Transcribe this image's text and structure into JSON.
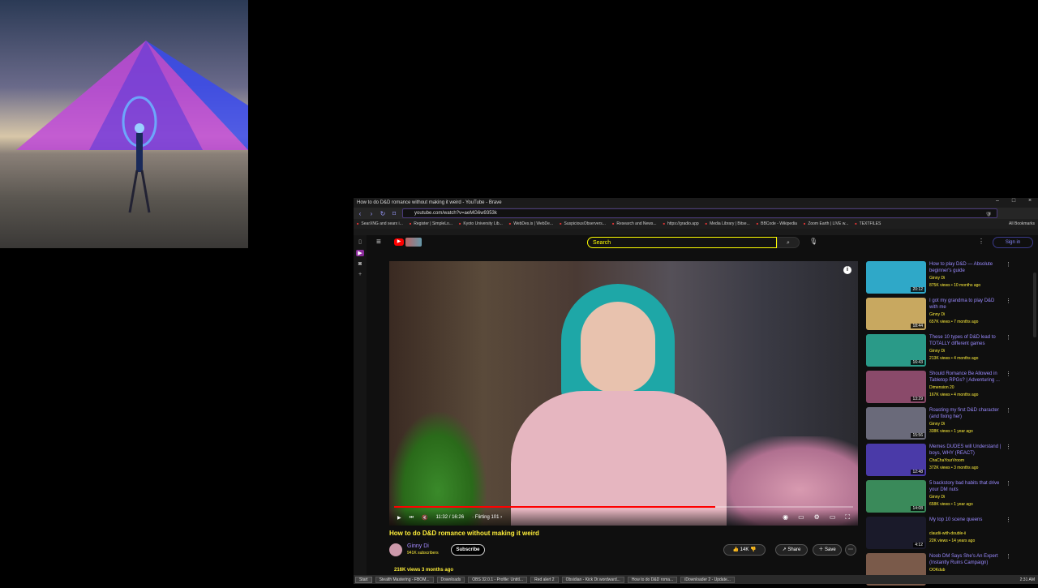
{
  "window": {
    "title": "How to do D&D romance without making it weird - YouTube - Brave",
    "minimize": "–",
    "maximize": "□",
    "close": "×"
  },
  "urlbar": {
    "back": "‹",
    "forward": "›",
    "reload": "↻",
    "bookmark": "⌑",
    "url": "youtube.com/watch?v=aeMG6w9353k"
  },
  "bookmarks": [
    "SearXNG and searx i...",
    "Register | SimpleLo...",
    "Kyoto University Lib...",
    "WebDes.is | WebDe...",
    "SuspiciousObservers...",
    "Research and News...",
    "https://gradio.app",
    "Media Library | Bitse...",
    "BBCode - Wikipedia",
    "Zoom Earth | LIVE w...",
    "TEXTFILES"
  ],
  "bookmarks_all": "All Bookmarks",
  "youtube": {
    "search_placeholder": "Search",
    "search_icon": "⌕",
    "mic_icon": "🎙",
    "sign_in": "Sign in",
    "video": {
      "time": "11:32 / 16:26",
      "chapter": "· Flirting 101 ›",
      "progress": 0.7,
      "title": "How to do D&D romance without making it weird",
      "channel": "Ginny Di",
      "subscribers": "941K subscribers",
      "subscribe_label": "Subscribe",
      "likes": "14K",
      "share": "Share",
      "save": "Save",
      "views": "216K views  3 months ago"
    },
    "recommendations": [
      {
        "title": "How to play D&D — Absolute beginner's guide",
        "channel": "Ginny Di",
        "meta": "875K views • 10 months ago",
        "duration": "20:12",
        "color": "#2fa8c8"
      },
      {
        "title": "I got my grandma to play D&D with me",
        "channel": "Ginny Di",
        "meta": "657K views • 7 months ago",
        "duration": "18:44",
        "color": "#c8a860"
      },
      {
        "title": "These 10 types of D&D lead to TOTALLY different games",
        "channel": "Ginny Di",
        "meta": "213K views • 4 months ago",
        "duration": "16:43",
        "color": "#2a9a88"
      },
      {
        "title": "Should Romance Be Allowed in Tabletop RPGs? | Adventuring ...",
        "channel": "Dimension 20",
        "meta": "167K views • 4 months ago",
        "duration": "13:29",
        "color": "#8a4a6a"
      },
      {
        "title": "Roasting my first D&D character (and fixing her)",
        "channel": "Ginny Di",
        "meta": "338K views • 1 year ago",
        "duration": "15:56",
        "color": "#6a6a7a"
      },
      {
        "title": "Memes DUDES will Understand | boys, WHY (REACT)",
        "channel": "ChaChaYourVroom",
        "meta": "372K views • 3 months ago",
        "duration": "12:48",
        "color": "#4a3aa8"
      },
      {
        "title": "5 backstory bad habits that drive your DM nuts",
        "channel": "Ginny Di",
        "meta": "658K views • 1 year ago",
        "duration": "14:08",
        "color": "#3a8a5a"
      },
      {
        "title": "My top 10 scene queens",
        "channel": "claudii-with-double-ii",
        "meta": "22K views • 14 years ago",
        "duration": "4:12",
        "color": "#1a1a2a"
      },
      {
        "title": "Noob DM Says She's An Expert (Instantly Ruins Campaign)",
        "channel": "OOKdub",
        "meta": "",
        "duration": "",
        "color": "#7a5a4a"
      }
    ]
  },
  "taskbar": {
    "start": "Start",
    "tasks": [
      "Stealth Mastering - FBOM...",
      "Downloads",
      "OBS 32.0.1 - Profile: Untitl...",
      "Red alert 2",
      "Obsidian - Kick Dr.wordward...",
      "How to do D&D roma...",
      "iDownloader 2 - Update..."
    ],
    "tray": "2:31 AM"
  }
}
